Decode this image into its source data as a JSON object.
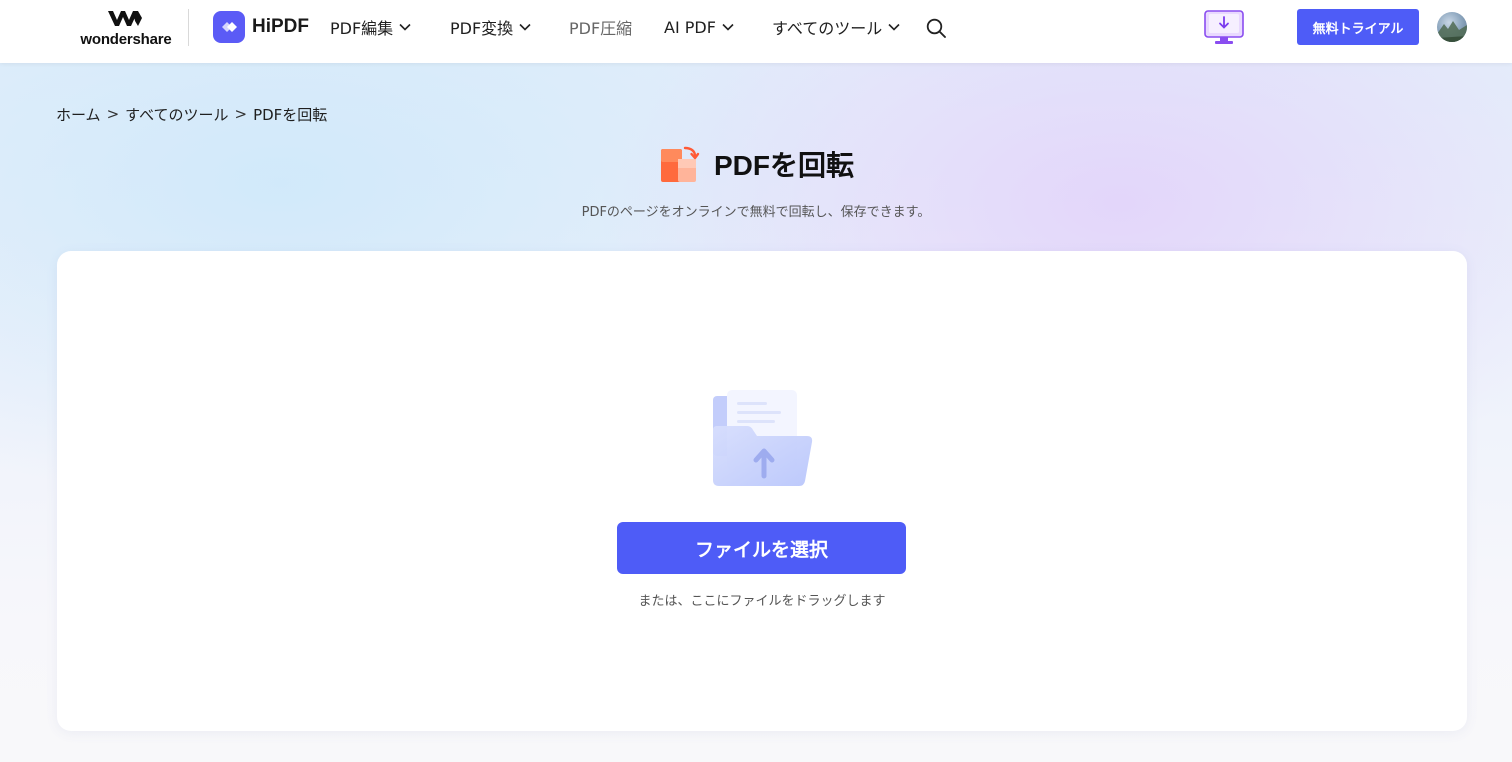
{
  "header": {
    "brand_text": "wondershare",
    "product_name": "HiPDF",
    "nav": [
      {
        "label": "PDF編集",
        "dropdown": true
      },
      {
        "label": "PDF変換",
        "dropdown": true
      },
      {
        "label": "PDF圧縮",
        "dropdown": false
      },
      {
        "label": "AI PDF",
        "dropdown": true
      },
      {
        "label": "すべてのツール",
        "dropdown": true
      }
    ],
    "trial_label": "無料トライアル"
  },
  "breadcrumb": {
    "items": [
      "ホーム",
      "すべてのツール",
      "PDFを回転"
    ],
    "separator": ">"
  },
  "page": {
    "title": "PDFを回転",
    "subtitle": "PDFのページをオンラインで無料で回転し、保存できます。"
  },
  "upload": {
    "button_label": "ファイルを選択",
    "hint": "または、ここにファイルをドラッグします"
  },
  "colors": {
    "accent": "#4e5cf7",
    "brand_icon": "#5b5bf6",
    "title_icon": "#ff5a36"
  },
  "icons": {
    "search": "search-icon",
    "download": "download-desktop-icon",
    "chevron": "chevron-down-icon",
    "rotate": "rotate-pdf-icon",
    "upload": "folder-upload-icon"
  }
}
